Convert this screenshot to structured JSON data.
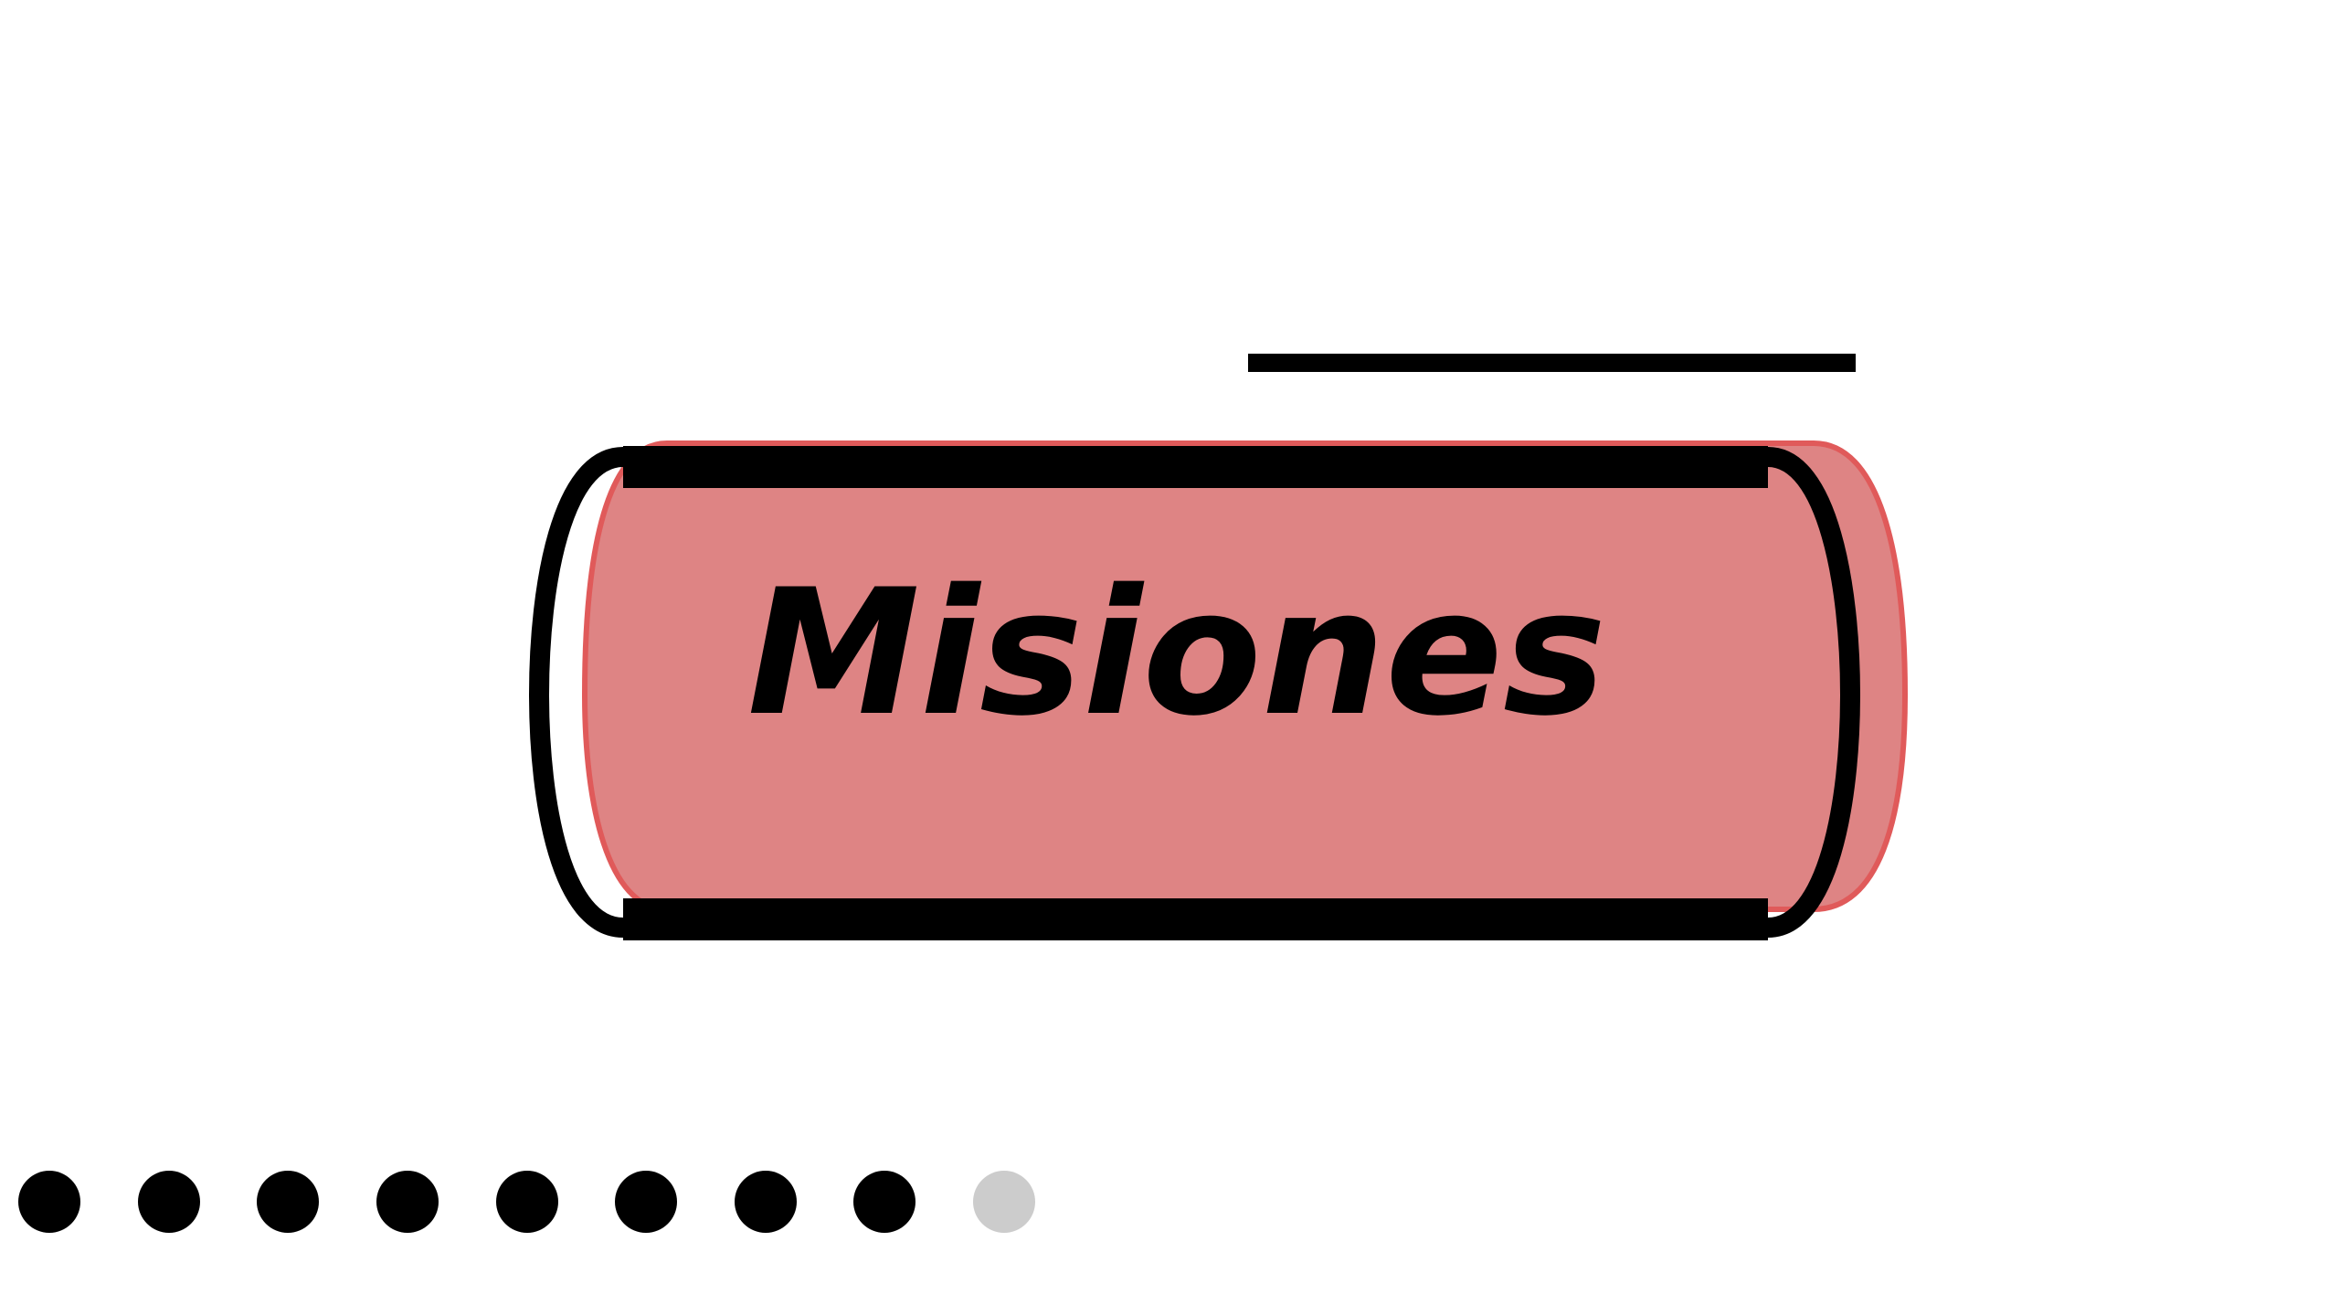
{
  "slide": {
    "title": "Misiones"
  },
  "colors": {
    "background": "#ffffff",
    "pill_fill": "#de8484",
    "pill_stroke": "#e05a5a",
    "outline": "#000000",
    "dot_active": "#000000",
    "dot_inactive": "#cccccc"
  },
  "pagination": {
    "total": 9,
    "current": 9,
    "completed": 8
  }
}
